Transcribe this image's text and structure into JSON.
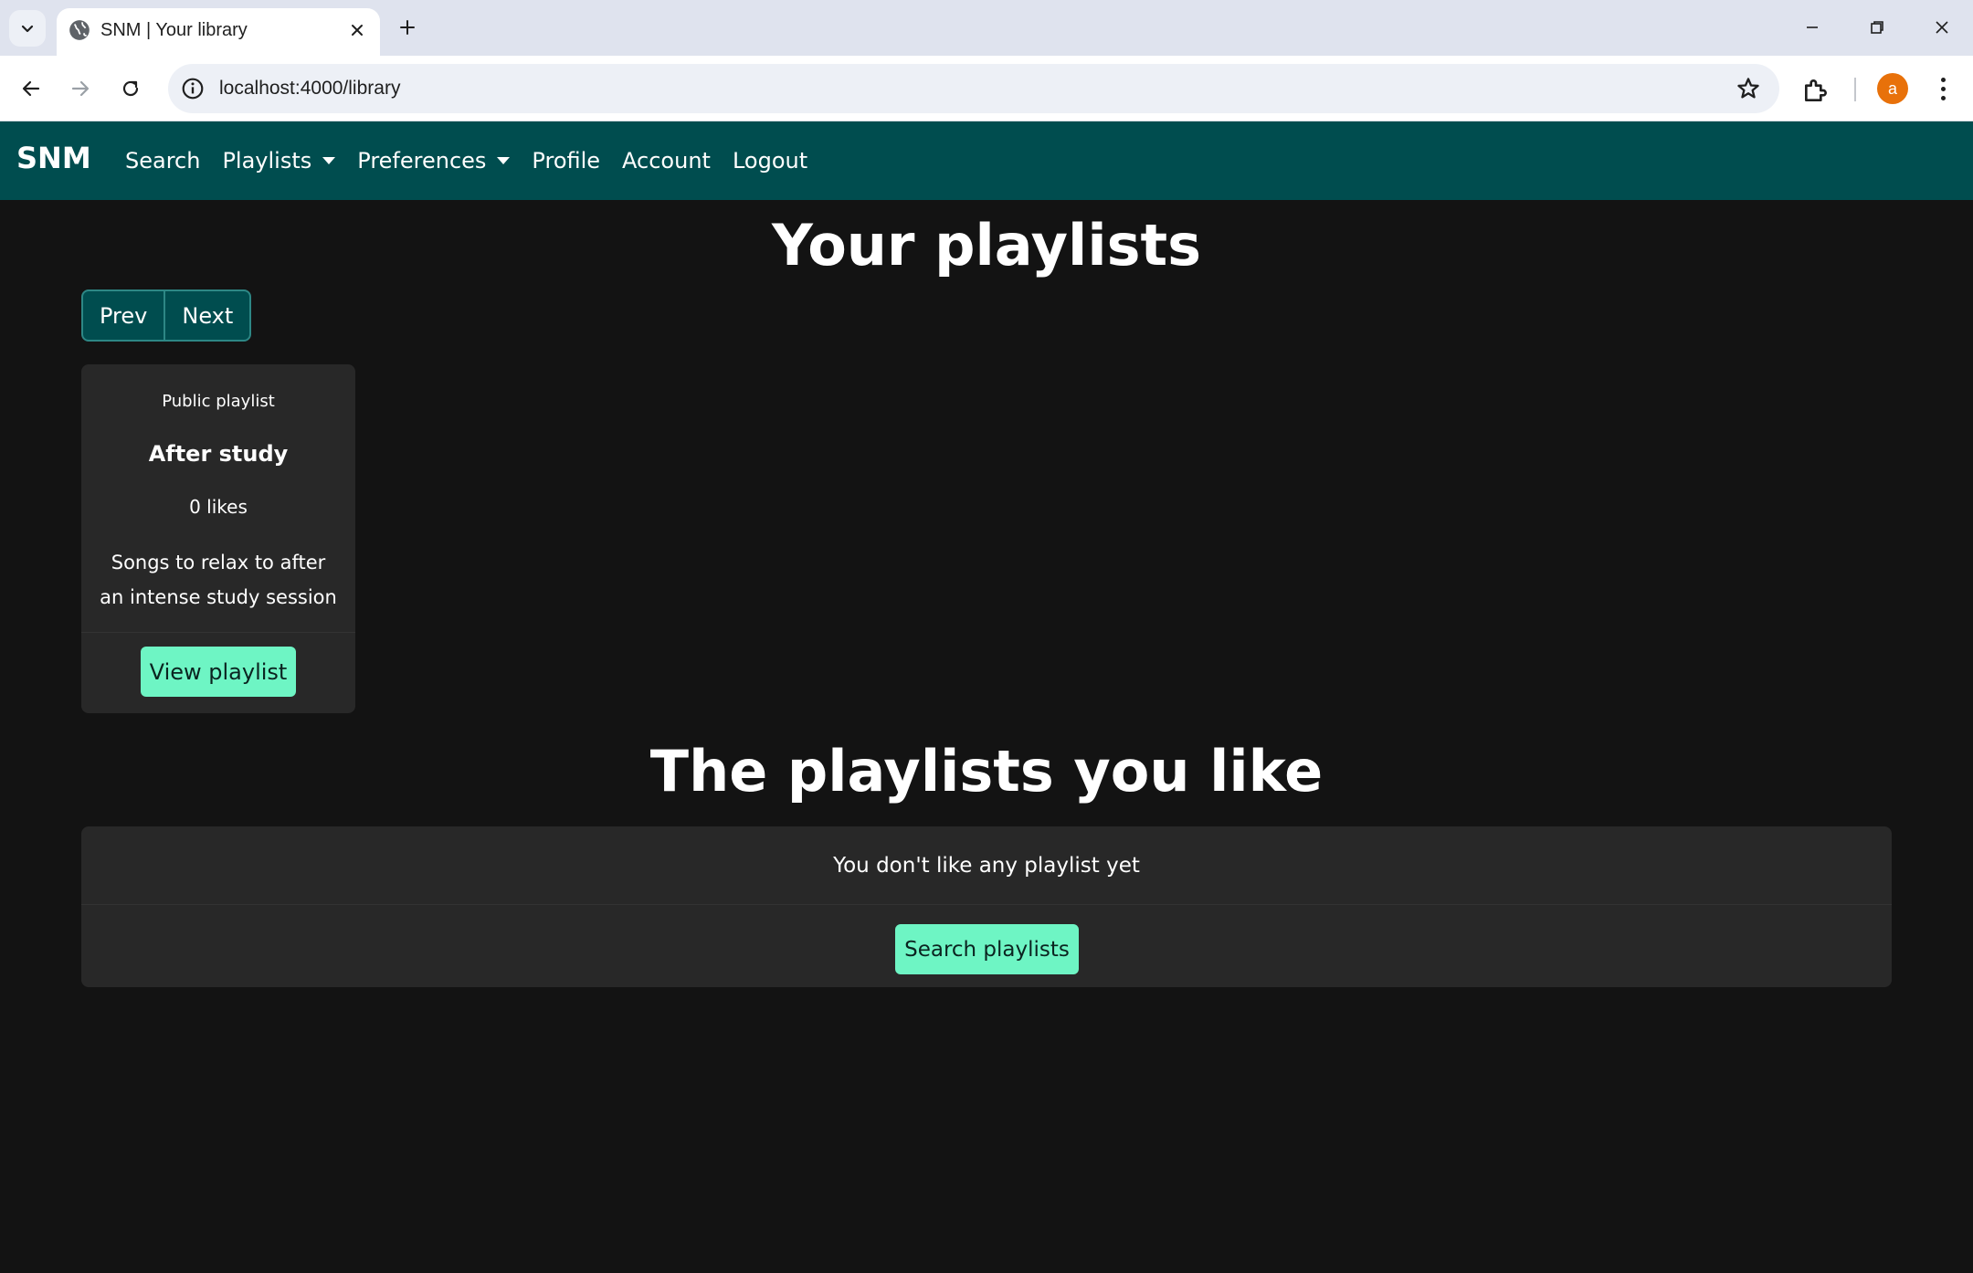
{
  "browser": {
    "tab_title": "SNM | Your library",
    "url": "localhost:4000/library",
    "profile_initial": "a"
  },
  "navbar": {
    "brand": "SNM",
    "links": [
      {
        "label": "Search",
        "dropdown": false
      },
      {
        "label": "Playlists",
        "dropdown": true
      },
      {
        "label": "Preferences",
        "dropdown": true
      },
      {
        "label": "Profile",
        "dropdown": false
      },
      {
        "label": "Account",
        "dropdown": false
      },
      {
        "label": "Logout",
        "dropdown": false
      }
    ],
    "bg_color": "#004d4f"
  },
  "your_playlists": {
    "heading": "Your playlists",
    "prev_label": "Prev",
    "next_label": "Next",
    "cards": [
      {
        "visibility": "Public playlist",
        "title": "After study",
        "likes": "0 likes",
        "description": "Songs to relax to after an intense study session",
        "button_label": "View playlist"
      }
    ]
  },
  "liked_playlists": {
    "heading": "The playlists you like",
    "empty_message": "You don't like any playlist yet",
    "button_label": "Search playlists"
  },
  "colors": {
    "accent": "#6ef5c4",
    "page_bg": "#131313",
    "card_bg": "#282828"
  }
}
